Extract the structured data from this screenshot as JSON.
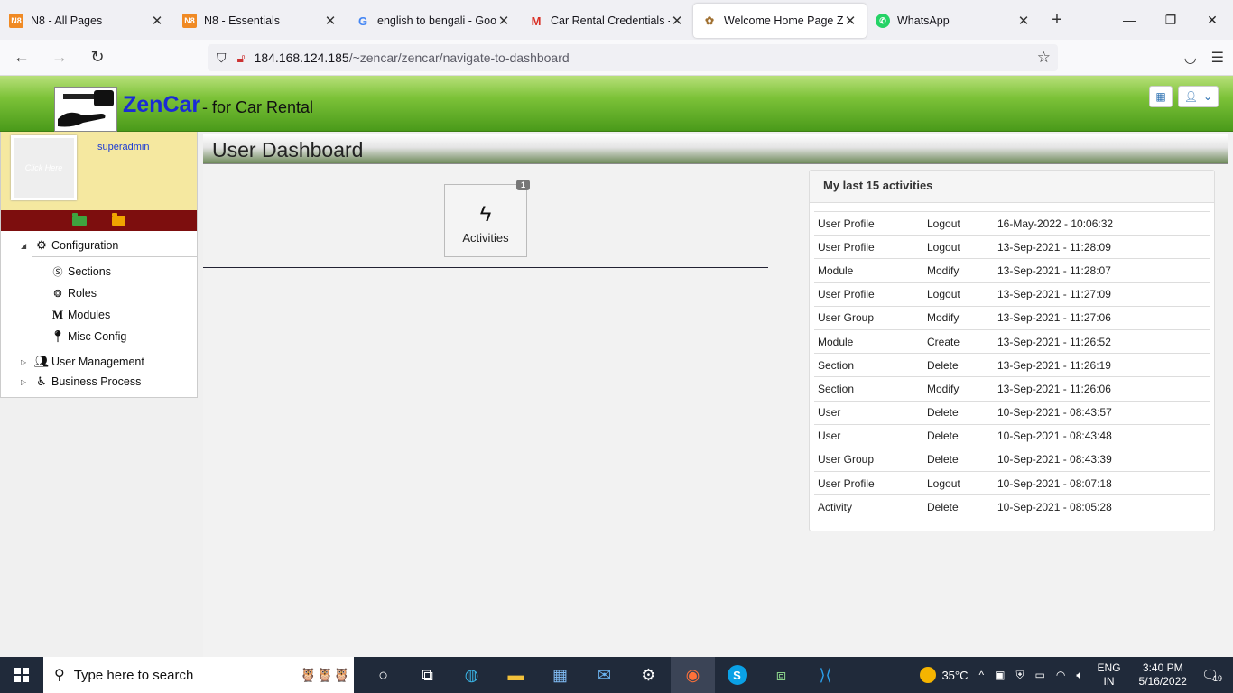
{
  "browser": {
    "tabs": [
      {
        "title": "N8 - All Pages",
        "favicon": "n8-icon"
      },
      {
        "title": "N8 - Essentials",
        "favicon": "n8-icon"
      },
      {
        "title": "english to bengali - Goog",
        "favicon": "google-icon"
      },
      {
        "title": "Car Rental Credentials - s",
        "favicon": "gmail-icon"
      },
      {
        "title": "Welcome Home Page  Ze",
        "favicon": "page-icon"
      },
      {
        "title": "WhatsApp",
        "favicon": "whatsapp-icon"
      }
    ],
    "active_tab_index": 4,
    "url_host": "184.168.124.185",
    "url_path": "/~zencar/zencar/navigate-to-dashboard"
  },
  "header": {
    "brand": "ZenCar",
    "brand_sub": "- for Car Rental"
  },
  "sidebar": {
    "avatar_text": "Click Here",
    "username": "superadmin",
    "menu": {
      "configuration": "Configuration",
      "sections": "Sections",
      "roles": "Roles",
      "modules": "Modules",
      "misc_config": "Misc Config",
      "user_management": "User Management",
      "business_process": "Business Process"
    }
  },
  "main": {
    "title": "User Dashboard",
    "tile": {
      "label": "Activities",
      "badge": "1"
    },
    "activities": {
      "title": "My last 15 activities",
      "rows": [
        {
          "entity": "User Profile",
          "action": "Logout",
          "time": "16-May-2022 - 10:06:32"
        },
        {
          "entity": "User Profile",
          "action": "Logout",
          "time": "13-Sep-2021 - 11:28:09"
        },
        {
          "entity": "Module",
          "action": "Modify",
          "time": "13-Sep-2021 - 11:28:07"
        },
        {
          "entity": "User Profile",
          "action": "Logout",
          "time": "13-Sep-2021 - 11:27:09"
        },
        {
          "entity": "User Group",
          "action": "Modify",
          "time": "13-Sep-2021 - 11:27:06"
        },
        {
          "entity": "Module",
          "action": "Create",
          "time": "13-Sep-2021 - 11:26:52"
        },
        {
          "entity": "Section",
          "action": "Delete",
          "time": "13-Sep-2021 - 11:26:19"
        },
        {
          "entity": "Section",
          "action": "Modify",
          "time": "13-Sep-2021 - 11:26:06"
        },
        {
          "entity": "User",
          "action": "Delete",
          "time": "10-Sep-2021 - 08:43:57"
        },
        {
          "entity": "User",
          "action": "Delete",
          "time": "10-Sep-2021 - 08:43:48"
        },
        {
          "entity": "User Group",
          "action": "Delete",
          "time": "10-Sep-2021 - 08:43:39"
        },
        {
          "entity": "User Profile",
          "action": "Logout",
          "time": "10-Sep-2021 - 08:07:18"
        },
        {
          "entity": "Activity",
          "action": "Delete",
          "time": "10-Sep-2021 - 08:05:28"
        }
      ]
    }
  },
  "taskbar": {
    "search_placeholder": "Type here to search",
    "weather": "35°C",
    "lang": "ENG",
    "region": "IN",
    "time": "3:40 PM",
    "date": "5/16/2022",
    "notifications": "19"
  },
  "colors": {
    "header_green": "#7cc238",
    "brand_blue": "#1a2bd6",
    "sidebar_bar": "#7d0e0e",
    "profile_bg": "#f5e8a0"
  }
}
